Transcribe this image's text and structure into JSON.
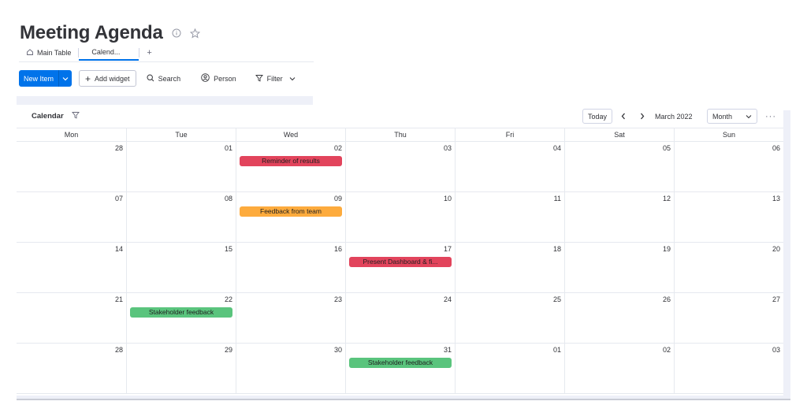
{
  "board": {
    "title": "Meeting Agenda",
    "info_icon": "info-circle-icon",
    "star_icon": "star-icon"
  },
  "views": {
    "tabs": [
      {
        "label": "Main Table",
        "icon": "home-icon"
      },
      {
        "label": "Calend...",
        "active": true
      }
    ],
    "add_label": "+"
  },
  "toolbar": {
    "new_item_label": "New Item",
    "add_widget_label": "Add widget",
    "search_label": "Search",
    "person_label": "Person",
    "filter_label": "Filter"
  },
  "calendar": {
    "title": "Calendar",
    "today_label": "Today",
    "month_label": "March 2022",
    "view_mode": "Month",
    "more_label": "···",
    "weekdays": [
      "Mon",
      "Tue",
      "Wed",
      "Thu",
      "Fri",
      "Sat",
      "Sun"
    ],
    "weeks": [
      [
        "28",
        "01",
        "02",
        "03",
        "04",
        "05",
        "06"
      ],
      [
        "07",
        "08",
        "09",
        "10",
        "11",
        "12",
        "13"
      ],
      [
        "14",
        "15",
        "16",
        "17",
        "18",
        "19",
        "20"
      ],
      [
        "21",
        "22",
        "23",
        "24",
        "25",
        "26",
        "27"
      ],
      [
        "28",
        "29",
        "30",
        "31",
        "01",
        "02",
        "03"
      ]
    ],
    "events": [
      {
        "label": "Reminder of results",
        "week": 0,
        "day": 2,
        "color": "#e2445c"
      },
      {
        "label": "Feedback from team",
        "week": 1,
        "day": 2,
        "color": "#fdab3d"
      },
      {
        "label": "Present Dashboard & fi...",
        "week": 2,
        "day": 3,
        "color": "#e2445c"
      },
      {
        "label": "Stakeholder feedback",
        "week": 3,
        "day": 1,
        "color": "#5ac47d"
      },
      {
        "label": "Stakeholder feedback",
        "week": 4,
        "day": 3,
        "color": "#5ac47d"
      }
    ]
  },
  "colors": {
    "primary": "#0073ea",
    "red_status": "#e2445c",
    "orange_status": "#fdab3d",
    "green_status": "#5ac47d"
  }
}
